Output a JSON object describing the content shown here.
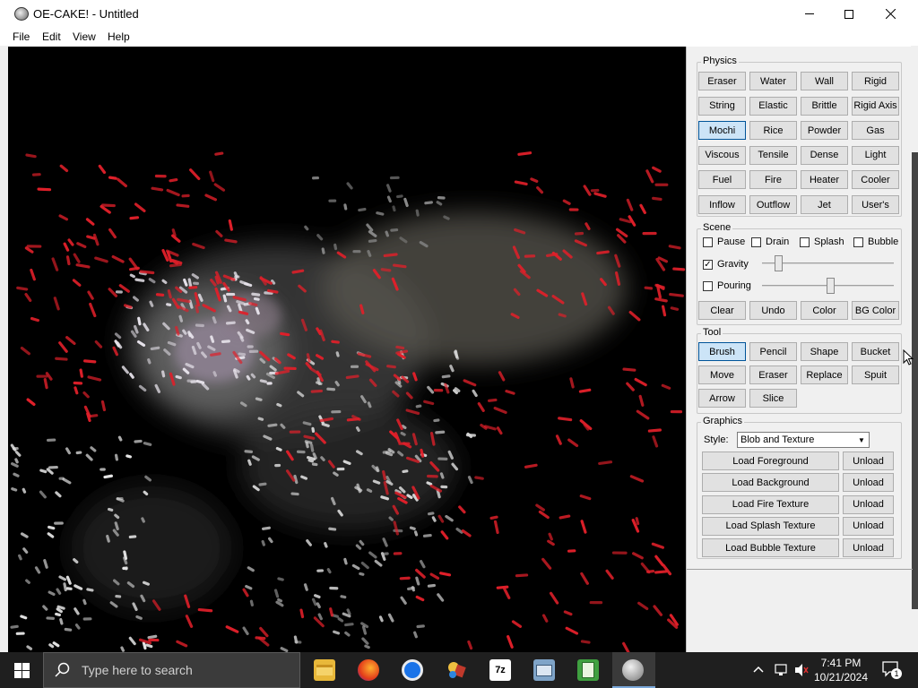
{
  "window": {
    "title": "OE-CAKE! - Untitled"
  },
  "menu": {
    "items": [
      "File",
      "Edit",
      "View",
      "Help"
    ]
  },
  "physics": {
    "label": "Physics",
    "buttons": [
      [
        "Eraser",
        "Water",
        "Wall",
        "Rigid"
      ],
      [
        "String",
        "Elastic",
        "Brittle",
        "Rigid Axis"
      ],
      [
        "Mochi",
        "Rice",
        "Powder",
        "Gas"
      ],
      [
        "Viscous",
        "Tensile",
        "Dense",
        "Light"
      ],
      [
        "Fuel",
        "Fire",
        "Heater",
        "Cooler"
      ],
      [
        "Inflow",
        "Outflow",
        "Jet",
        "User's"
      ]
    ],
    "selected": "Mochi"
  },
  "scene": {
    "label": "Scene",
    "checks": [
      {
        "label": "Pause",
        "checked": false
      },
      {
        "label": "Drain",
        "checked": false
      },
      {
        "label": "Splash",
        "checked": false
      },
      {
        "label": "Bubble",
        "checked": false
      }
    ],
    "gravity": {
      "label": "Gravity",
      "checked": true,
      "level": 0.12
    },
    "pouring": {
      "label": "Pouring",
      "checked": false,
      "level": 0.52
    },
    "buttons": [
      "Clear",
      "Undo",
      "Color",
      "BG Color"
    ]
  },
  "tool": {
    "label": "Tool",
    "buttons": [
      [
        "Brush",
        "Pencil",
        "Shape",
        "Bucket"
      ],
      [
        "Move",
        "Eraser",
        "Replace",
        "Spuit"
      ],
      [
        "Arrow",
        "Slice"
      ]
    ],
    "selected": "Brush"
  },
  "graphics": {
    "label": "Graphics",
    "style_label": "Style:",
    "style_value": "Blob and Texture",
    "rows": [
      {
        "load": "Load Foreground",
        "unload": "Unload"
      },
      {
        "load": "Load Background",
        "unload": "Unload"
      },
      {
        "load": "Load Fire Texture",
        "unload": "Unload"
      },
      {
        "load": "Load Splash Texture",
        "unload": "Unload"
      },
      {
        "load": "Load Bubble Texture",
        "unload": "Unload"
      }
    ]
  },
  "taskbar": {
    "search_placeholder": "Type here to search",
    "time": "7:41 PM",
    "date": "10/21/2024",
    "notification_count": "1",
    "apps": [
      "file-explorer-icon",
      "firefox-icon",
      "chrome-icon",
      "paint-app-icon",
      "7zip-icon",
      "picture-viewer-icon",
      "notepad-icon",
      "oe-cake-icon"
    ],
    "label_7zip": "7z"
  }
}
